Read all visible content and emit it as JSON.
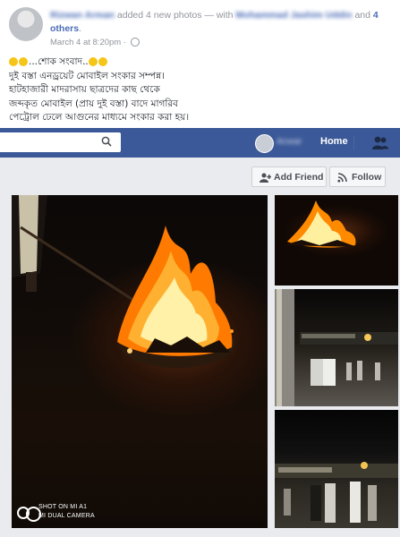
{
  "post": {
    "author": "Rizwan Arman",
    "added_text": "added 4 new photos — with",
    "tagged": "Mohammad Jashim Uddin",
    "and_text": "and",
    "others": "4 others",
    "period": ".",
    "time": "March 4 at 8:20pm",
    "separator": "·",
    "lines": [
      "শোক সংবাদ",
      "দুই বস্তা এনড্রয়েট মোবাইল সংকার সম্পন্ন।",
      "হাটহাজারী মাদরাসায় ছাত্রদের কাছ থেকে",
      "জব্দকৃত মোবাইল (প্রায় দুই বস্তা) বাদে মাগরিব",
      "পেট্রোল ঢেলে আগুনের মাধ্যমে সংকার করা হয়।"
    ]
  },
  "navbar": {
    "user_name": "Anwar",
    "home_label": "Home"
  },
  "actions": {
    "add_friend": "Add Friend",
    "follow": "Follow"
  },
  "photo": {
    "camera_line1": "SHOT ON MI A1",
    "camera_line2": "MI DUAL CAMERA"
  },
  "icons": [
    "search-icon",
    "friends-icon",
    "add-friend-icon",
    "follow-icon",
    "globe-icon"
  ],
  "colors": {
    "brand": "#3b5998",
    "link": "#4b6cb7",
    "meta": "#90949c"
  }
}
